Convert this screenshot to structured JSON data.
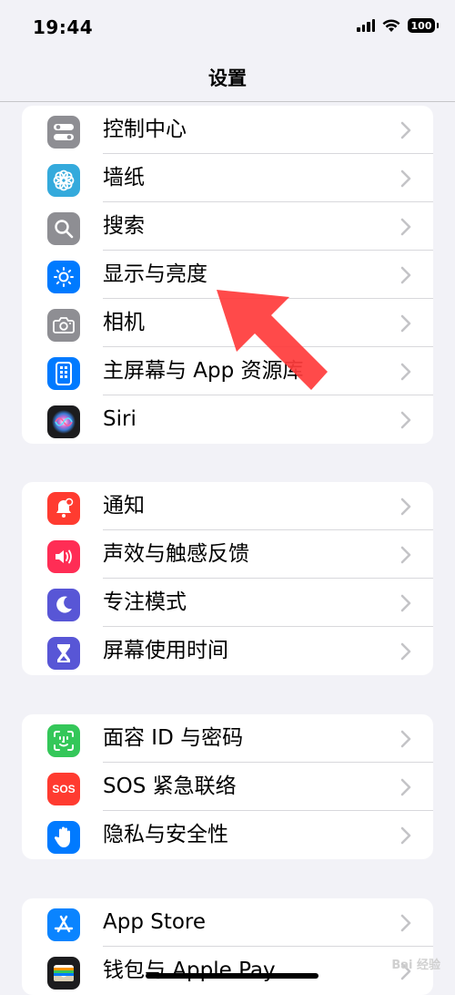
{
  "status_bar": {
    "time": "19:44",
    "battery": "100"
  },
  "nav": {
    "title": "设置"
  },
  "groups": [
    [
      {
        "id": "control-center",
        "label": "控制中心",
        "icon": "toggle-icon",
        "color": "#8e8e93"
      },
      {
        "id": "wallpaper",
        "label": "墙纸",
        "icon": "flower-icon",
        "color": "#34aadc"
      },
      {
        "id": "search",
        "label": "搜索",
        "icon": "search-icon",
        "color": "#8e8e93"
      },
      {
        "id": "display",
        "label": "显示与亮度",
        "icon": "sun-icon",
        "color": "#007aff"
      },
      {
        "id": "camera",
        "label": "相机",
        "icon": "camera-icon",
        "color": "#8e8e93"
      },
      {
        "id": "home-screen",
        "label": "主屏幕与 App 资源库",
        "icon": "phone-grid-icon",
        "color": "#007aff"
      },
      {
        "id": "siri",
        "label": "Siri",
        "icon": "siri-icon",
        "color": "#1c1c1e"
      }
    ],
    [
      {
        "id": "notifications",
        "label": "通知",
        "icon": "bell-icon",
        "color": "#ff3b30"
      },
      {
        "id": "sounds",
        "label": "声效与触感反馈",
        "icon": "speaker-icon",
        "color": "#ff2d55"
      },
      {
        "id": "focus",
        "label": "专注模式",
        "icon": "moon-icon",
        "color": "#5856d6"
      },
      {
        "id": "screen-time",
        "label": "屏幕使用时间",
        "icon": "hourglass-icon",
        "color": "#5856d6"
      }
    ],
    [
      {
        "id": "face-id",
        "label": "面容 ID 与密码",
        "icon": "face-id-icon",
        "color": "#34c759"
      },
      {
        "id": "sos",
        "label": "SOS 紧急联络",
        "icon": "sos-icon",
        "color": "#ff3b30",
        "icon_text": "SOS"
      },
      {
        "id": "privacy",
        "label": "隐私与安全性",
        "icon": "hand-icon",
        "color": "#007aff"
      }
    ],
    [
      {
        "id": "app-store",
        "label": "App Store",
        "icon": "app-store-icon",
        "color": "#0a84ff"
      },
      {
        "id": "wallet",
        "label": "钱包与 Apple Pay",
        "icon": "wallet-icon",
        "color": "#1c1c1e"
      }
    ]
  ],
  "watermark": "Bai 经验"
}
